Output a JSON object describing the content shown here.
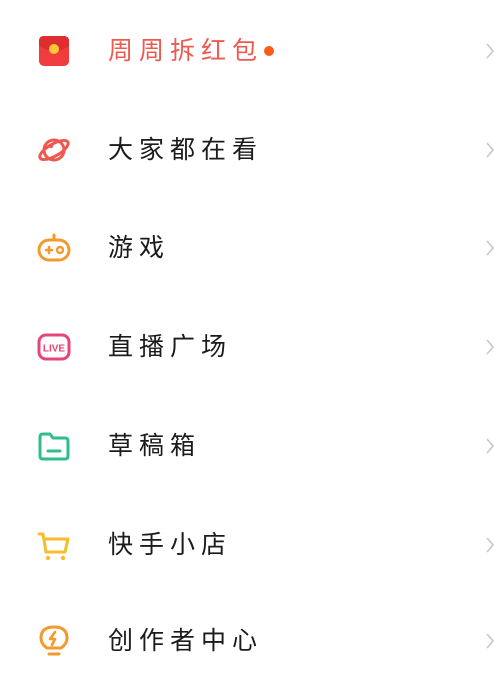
{
  "menu": {
    "items": [
      {
        "label": "周周拆红包",
        "icon": "red-envelope-icon",
        "highlight": true,
        "badge_dot": true
      },
      {
        "label": "大家都在看",
        "icon": "planet-icon"
      },
      {
        "label": "游戏",
        "icon": "gamepad-icon"
      },
      {
        "label": "直播广场",
        "icon": "live-icon"
      },
      {
        "label": "草稿箱",
        "icon": "folder-icon"
      },
      {
        "label": "快手小店",
        "icon": "shopping-cart-icon"
      },
      {
        "label": "创作者中心",
        "icon": "lightbulb-icon"
      }
    ]
  },
  "colors": {
    "highlight_text": "#ee5a4f",
    "badge_dot": "#ff5a17",
    "red_envelope": "#f03c3c",
    "planet": "#f0574f",
    "gamepad": "#f39a2c",
    "live": "#e7457a",
    "folder": "#2fbd8f",
    "cart": "#f5be2e",
    "lightbulb": "#f39a2c",
    "chevron": "#c8c8c8"
  }
}
